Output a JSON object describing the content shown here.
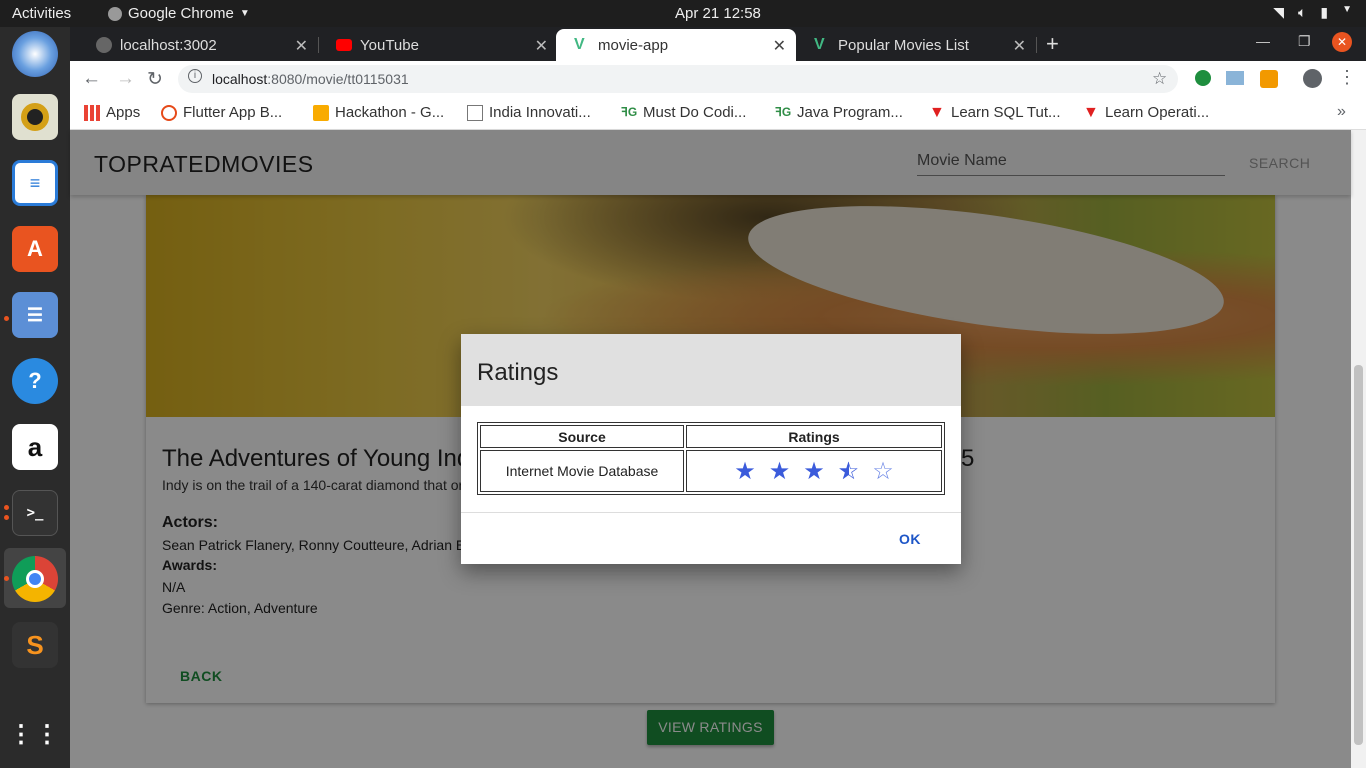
{
  "os": {
    "activities": "Activities",
    "app_name": "Google Chrome",
    "clock": "Apr 21  12:58"
  },
  "browser": {
    "tabs": [
      {
        "label": "localhost:3002"
      },
      {
        "label": "YouTube"
      },
      {
        "label": "movie-app"
      },
      {
        "label": "Popular Movies List"
      }
    ],
    "url_host": "localhost",
    "url_path": ":8080/movie/tt0115031",
    "bookmarks": [
      {
        "label": "Apps"
      },
      {
        "label": "Flutter App B..."
      },
      {
        "label": "Hackathon - G..."
      },
      {
        "label": "India Innovati..."
      },
      {
        "label": "Must Do Codi..."
      },
      {
        "label": "Java Program..."
      },
      {
        "label": "Learn SQL Tut..."
      },
      {
        "label": "Learn Operati..."
      }
    ]
  },
  "app": {
    "brand": "TOPRATEDMOVIES",
    "search_placeholder": "Movie Name",
    "search_button": "SEARCH",
    "movie": {
      "title_start": "The Adventures of Young Ind",
      "title_end": "5",
      "plot": "Indy is on the trail of a 140-carat diamond that or",
      "actors_label": "Actors:",
      "actors": "Sean Patrick Flanery, Ronny Coutteure, Adrian Ed",
      "awards_label": "Awards:",
      "awards": "N/A",
      "genre": "Genre: Action, Adventure"
    },
    "back_button": "BACK",
    "view_ratings_button": "VIEW RATINGS"
  },
  "dialog": {
    "title": "Ratings",
    "col_source": "Source",
    "col_ratings": "Ratings",
    "rows": [
      {
        "source": "Internet Movie Database",
        "stars": 3.5,
        "max_stars": 5
      }
    ],
    "ok_button": "OK"
  }
}
